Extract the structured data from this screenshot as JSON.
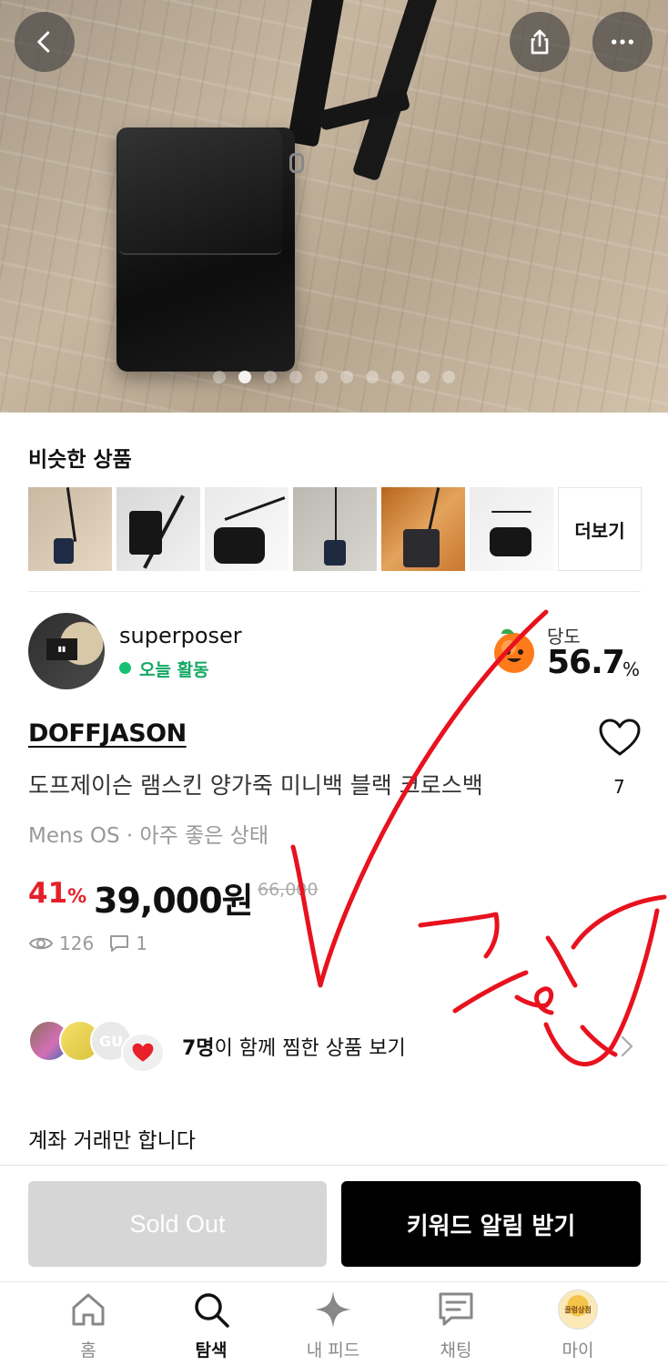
{
  "similar": {
    "title": "비슷한 상품",
    "more_label": "더보기"
  },
  "seller": {
    "name": "superposer",
    "activity": "오늘 활동",
    "sweetness_label": "당도",
    "sweetness_value": "56.7",
    "sweetness_unit": "%"
  },
  "product": {
    "brand": "DOFFJASON",
    "name": "도프제이슨 램스킨 양가죽 미니백 블랙 크로스백",
    "condition": "Mens OS · 아주 좋은 상태",
    "discount_value": "41",
    "discount_unit": "%",
    "price": "39,000원",
    "original_price": "66,000",
    "like_count": "7",
    "views": "126",
    "comments": "1"
  },
  "likers": {
    "count_text": "7명",
    "rest_text": "이 함께 찜한 상품 보기",
    "avatar3_text": "GU"
  },
  "notice": "계좌 거래만 합니다",
  "actions": {
    "sold_out": "Sold Out",
    "keyword_alert": "키워드 알림 받기"
  },
  "tabs": {
    "home": "홈",
    "search": "탐색",
    "feed": "내 피드",
    "chat": "채팅",
    "my": "마이",
    "my_avatar_text": "끌렁상점"
  },
  "image_carousel": {
    "total": 10,
    "current": 1
  }
}
